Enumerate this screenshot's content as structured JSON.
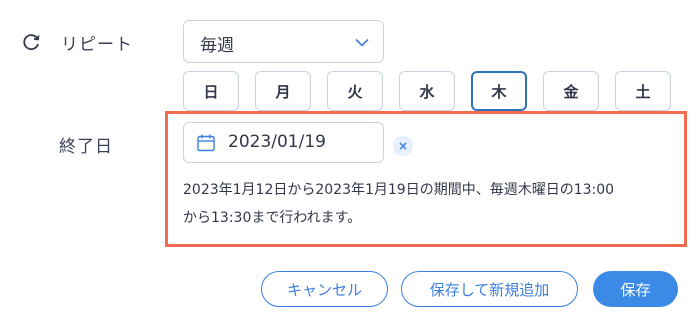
{
  "repeat": {
    "icon": "repeat-icon",
    "label": "リピート",
    "select_value": "毎週",
    "select_icon": "chevron-down-icon"
  },
  "days": [
    {
      "label": "日",
      "selected": false
    },
    {
      "label": "月",
      "selected": false
    },
    {
      "label": "火",
      "selected": false
    },
    {
      "label": "水",
      "selected": false
    },
    {
      "label": "木",
      "selected": true
    },
    {
      "label": "金",
      "selected": false
    },
    {
      "label": "土",
      "selected": false
    }
  ],
  "end_date": {
    "label": "終了日",
    "icon": "calendar-icon",
    "value": "2023/01/19",
    "clear_label": "×"
  },
  "summary": {
    "line1": "2023年1月12日から2023年1月19日の期間中、毎週木曜日の13:00",
    "line2": "から13:30まで行われます。"
  },
  "buttons": {
    "cancel": "キャンセル",
    "save_new": "保存して新規追加",
    "save": "保存"
  },
  "colors": {
    "accent": "#3b7fe0",
    "highlight": "#f26d4f",
    "selected_border": "#2f72b9"
  }
}
